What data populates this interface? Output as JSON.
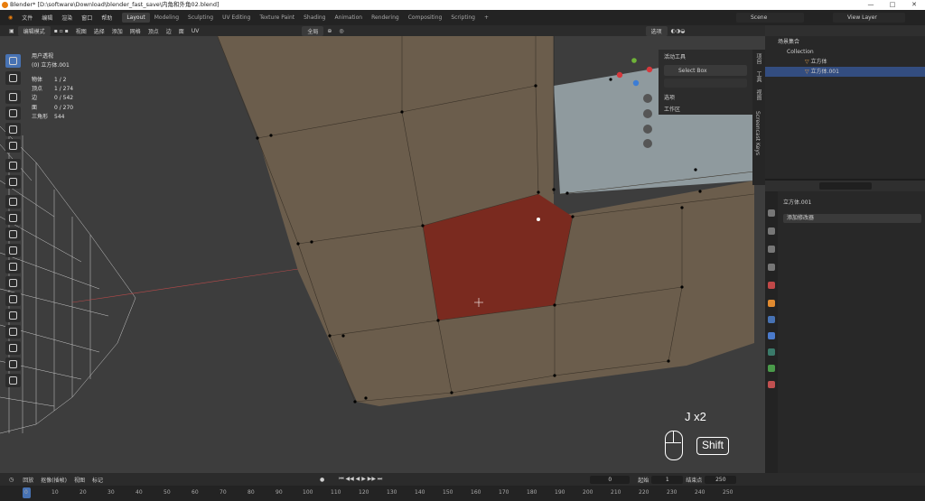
{
  "window": {
    "title": "Blender* [D:\\software\\Download\\blender_fast_save\\内角和外角02.blend]",
    "ctrl": [
      "—",
      "□",
      "✕"
    ]
  },
  "menu": {
    "items": [
      "文件",
      "编辑",
      "渲染",
      "窗口",
      "帮助"
    ],
    "workspaces": [
      "Layout",
      "Modeling",
      "Sculpting",
      "UV Editing",
      "Texture Paint",
      "Shading",
      "Animation",
      "Rendering",
      "Compositing",
      "Scripting"
    ],
    "add": "+"
  },
  "scene": {
    "label": "Scene"
  },
  "view_layer": {
    "label": "View Layer"
  },
  "viewport_header": {
    "mode": "编辑模式",
    "menus": [
      "视图",
      "选择",
      "添加",
      "网格",
      "顶点",
      "边",
      "面",
      "UV"
    ],
    "orientation": "全局",
    "overlay_options": "选项"
  },
  "overlay": {
    "view_name": "用户透视",
    "object_name": "(0) 立方体.001",
    "stats": [
      {
        "k": "物体",
        "v": "1 / 2"
      },
      {
        "k": "顶点",
        "v": "1 / 274"
      },
      {
        "k": "边",
        "v": "0 / 542"
      },
      {
        "k": "面",
        "v": "0 / 270"
      },
      {
        "k": "三角形",
        "v": "544"
      }
    ]
  },
  "tool_panel": {
    "header": "活动工具",
    "tool": "Select Box",
    "section1": "选项",
    "section2": "工作区"
  },
  "n_tabs": [
    "项目",
    "工具",
    "视图",
    "Screencast Keys"
  ],
  "keys": {
    "combo": "J x2",
    "modifier": "Shift"
  },
  "outliner": {
    "root": "场景集合",
    "collection": "Collection",
    "obj1": "立方体",
    "obj2": "立方体.001"
  },
  "properties": {
    "object_name": "立方体.001",
    "add_modifier": "添加修改器"
  },
  "timeline": {
    "playback": "回放",
    "keying": "抠像(插帧)",
    "view": "视图",
    "marker": "标记",
    "current": "0",
    "start_label": "起始",
    "start": "1",
    "end_label": "结束点",
    "end": "250"
  },
  "ruler": {
    "ticks": [
      "0",
      "10",
      "20",
      "30",
      "40",
      "50",
      "60",
      "70",
      "80",
      "90",
      "100",
      "110",
      "120",
      "130",
      "140",
      "150",
      "160",
      "170",
      "180",
      "190",
      "200",
      "210",
      "220",
      "230",
      "240",
      "250"
    ]
  },
  "colors": {
    "accent": "#4772b3",
    "face_selected": "#7a2a1f",
    "mesh": "#6b5d4c",
    "active_ws": "#3d3d3d"
  }
}
